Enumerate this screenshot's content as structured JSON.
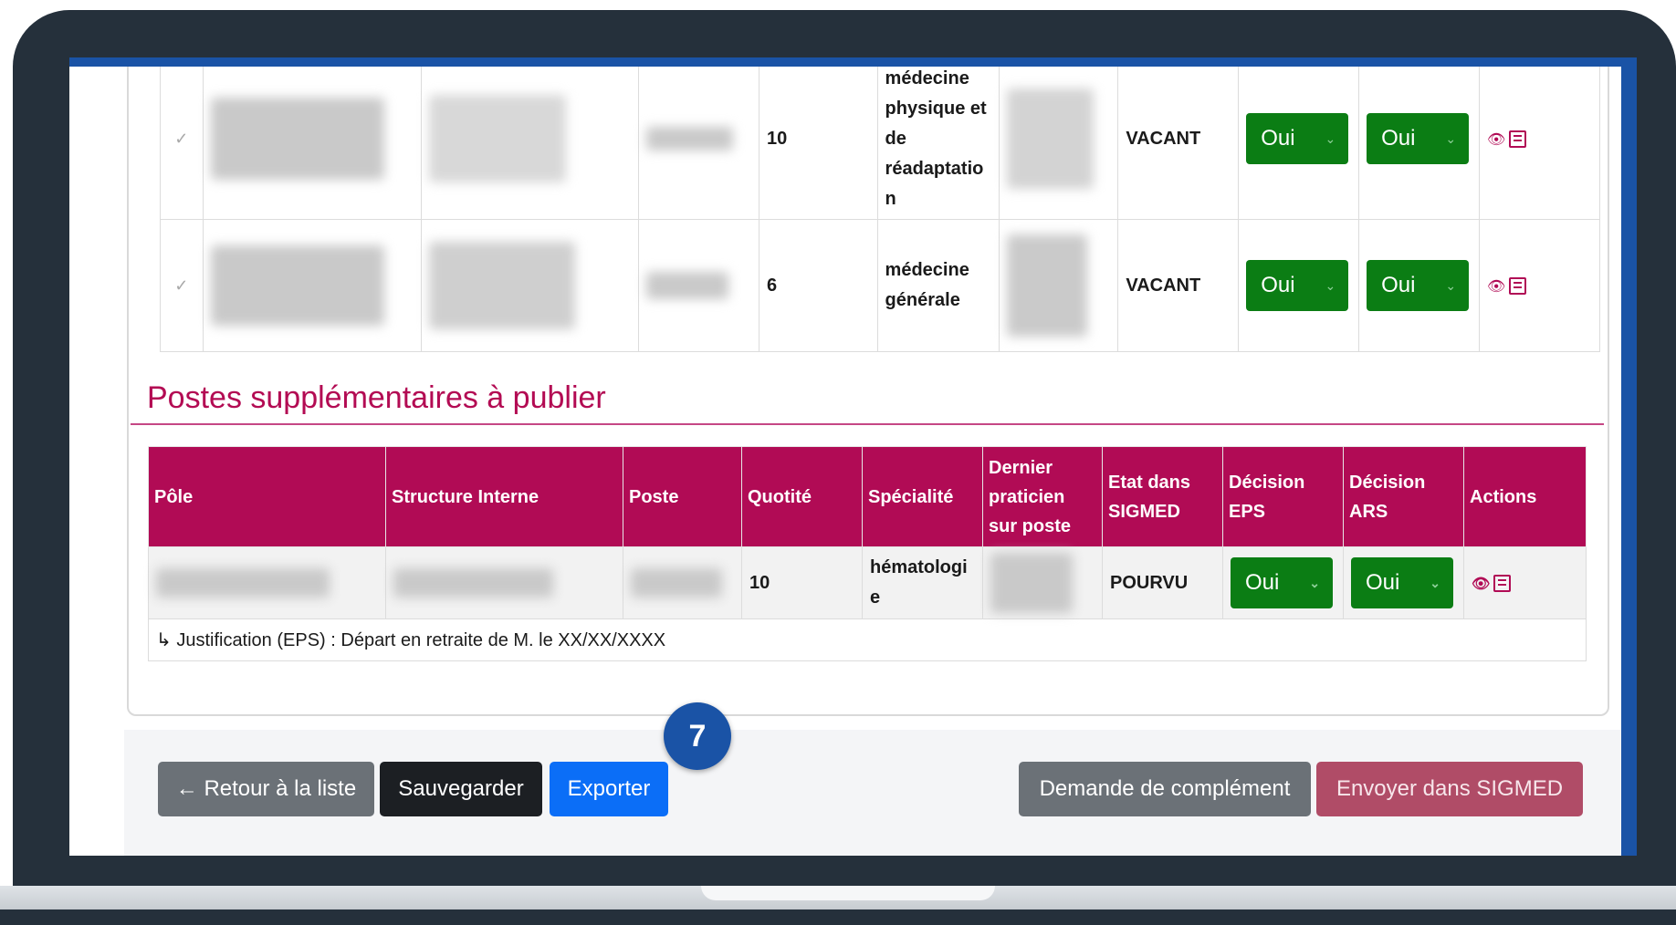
{
  "upper_table": {
    "rows": [
      {
        "quotite": "10",
        "specialite": "médecine physique et de réadaptation",
        "specialite_lines": [
          "médecine",
          "physique et",
          "de",
          "réadaptatio",
          "n"
        ],
        "etat": "VACANT",
        "decision_eps": "Oui",
        "decision_ars": "Oui"
      },
      {
        "quotite": "6",
        "specialite": "médecine générale",
        "specialite_lines": [
          "médecine",
          "générale"
        ],
        "etat": "VACANT",
        "decision_eps": "Oui",
        "decision_ars": "Oui"
      }
    ]
  },
  "section": {
    "title": "Postes supplémentaires à publier"
  },
  "lower_table": {
    "headers": {
      "pole": "Pôle",
      "structure": "Structure Interne",
      "poste": "Poste",
      "quotite": "Quotité",
      "specialite": "Spécialité",
      "dernier_praticien": "Dernier praticien sur poste",
      "etat": "Etat dans SIGMED",
      "decision_eps": "Décision EPS",
      "decision_ars": "Décision ARS",
      "actions": "Actions"
    },
    "row": {
      "quotite": "10",
      "specialite_lines": [
        "hématologi",
        "e"
      ],
      "etat": "POURVU",
      "decision_eps": "Oui",
      "decision_ars": "Oui"
    },
    "justification": "↳ Justification (EPS) : Départ en retraite de M. le XX/XX/XXXX"
  },
  "footer": {
    "back_label": "← Retour à la liste",
    "save_label": "Sauvegarder",
    "export_label": "Exporter",
    "complement_label": "Demande de complément",
    "send_label": "Envoyer dans SIGMED"
  },
  "annotation": {
    "step_number": "7"
  },
  "icons": {
    "row_check": "check-icon",
    "select_chevron": "chevron-down-icon",
    "view": "eye-icon",
    "details": "document-icon",
    "justification_arrow": "return-arrow-icon"
  },
  "colors": {
    "header_bg": "#b10b55",
    "section_title": "#b30b53",
    "decision_green": "#0b7d14",
    "export_blue": "#0b6ef7",
    "send_pink": "#b04c67",
    "badge_blue": "#1a53a6",
    "laptop_frame": "#25303b"
  }
}
